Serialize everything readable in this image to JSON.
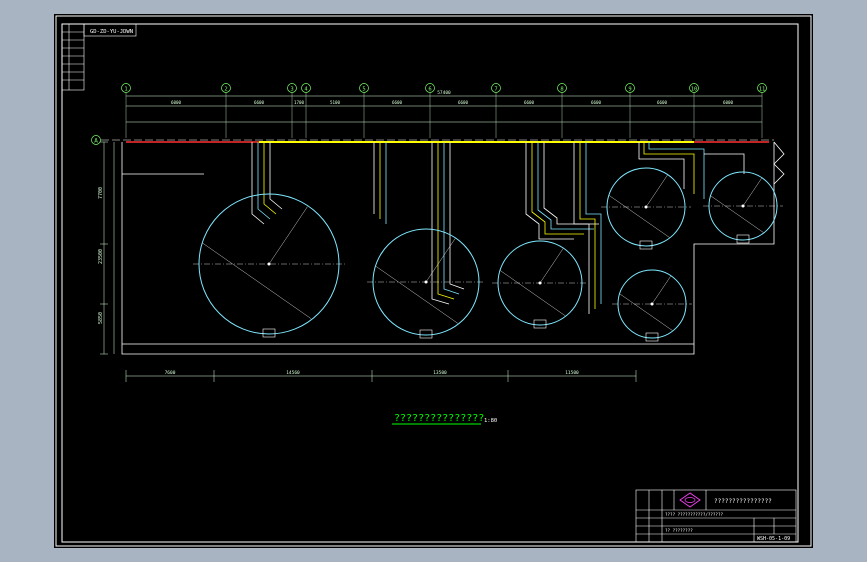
{
  "colors": {
    "viewport_bg": "#a9b4c3",
    "sheet_bg": "#000000",
    "frame": "#ffffff",
    "tank": "#7ee8ff",
    "dimension": "#d8ffd8",
    "axis": "#7cff6a",
    "pipe_yellow": "#ffff00",
    "pipe_red": "#ff3030",
    "centerline": "#ffffff",
    "caption": "#00ff00",
    "logo": "#ff40ff"
  },
  "drawing_number": "GD-ZD-YU-JDWN",
  "axis_labels": [
    "1",
    "2",
    "3",
    "4",
    "5",
    "6",
    "7",
    "8",
    "9",
    "10",
    "11"
  ],
  "row_label": "A",
  "top_dimensions": [
    "6000",
    "6600",
    "1700",
    "5100",
    "6600",
    "6600",
    "6600",
    "6600",
    "6600",
    "6000"
  ],
  "total_dimension": "57400",
  "bottom_dimensions": [
    "7600",
    "14560",
    "13500",
    "11500"
  ],
  "side_dimensions": [
    "7700",
    "23500",
    "5850"
  ],
  "drawing_caption": "???????????????",
  "caption_scale": "1:80",
  "title_block": {
    "project_title": "????????????????",
    "drawing_code": "WSH-05-1-09",
    "row_text_1": "???? ???????????/??????",
    "row_text_2": "?? ????????"
  },
  "icons": [
    "company-logo-icon"
  ]
}
